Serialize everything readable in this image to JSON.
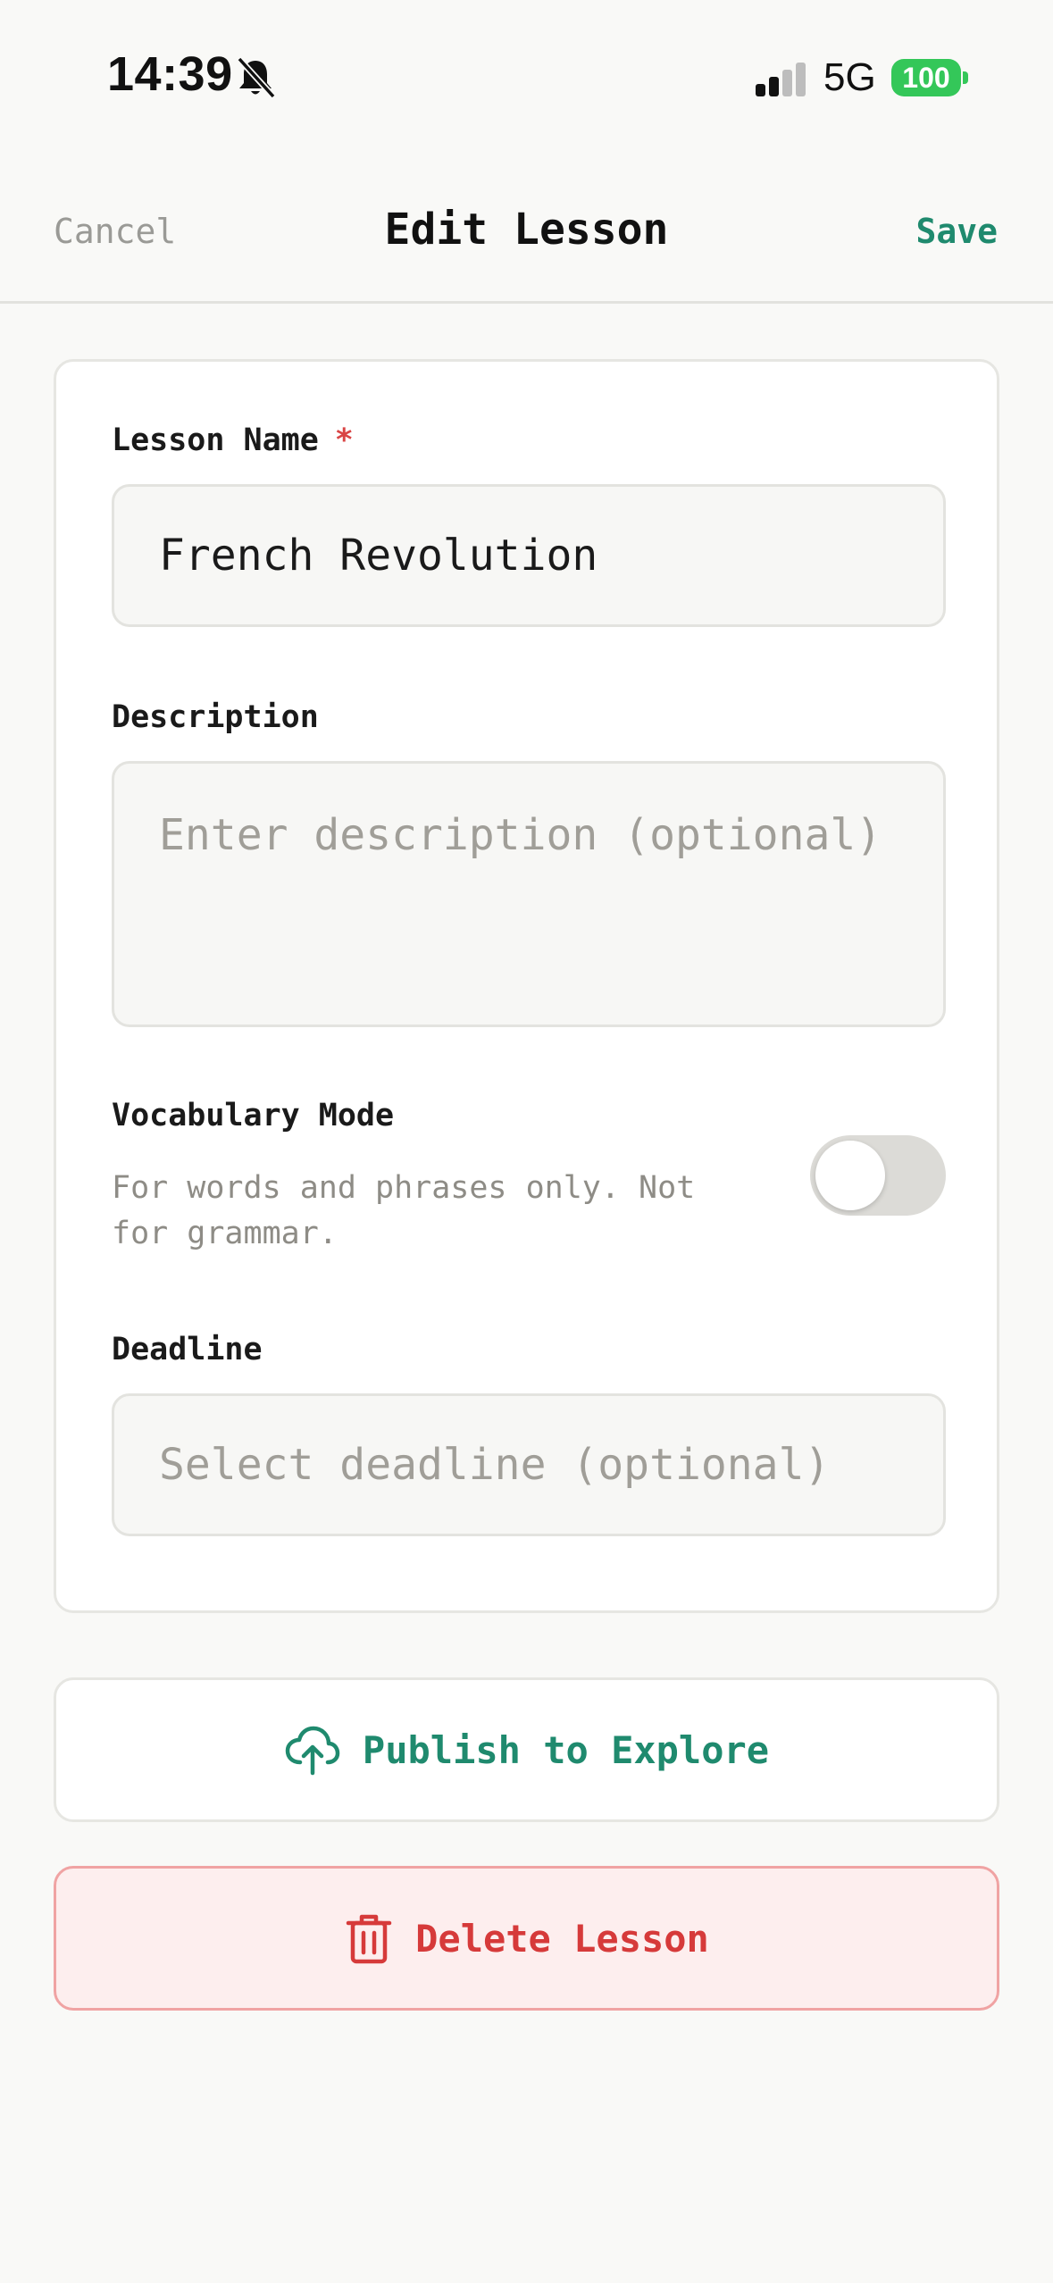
{
  "status_bar": {
    "time": "14:39",
    "network": "5G",
    "battery": "100",
    "icons": [
      "bell-slash-icon",
      "signal-icon"
    ]
  },
  "nav": {
    "cancel_label": "Cancel",
    "title": "Edit Lesson",
    "save_label": "Save"
  },
  "form": {
    "lesson_name": {
      "label": "Lesson Name",
      "required_mark": "*",
      "value": "French Revolution"
    },
    "description": {
      "label": "Description",
      "placeholder": "Enter description (optional)",
      "value": ""
    },
    "vocabulary_mode": {
      "label": "Vocabulary Mode",
      "helper": "For words and phrases only. Not for grammar.",
      "enabled": false
    },
    "deadline": {
      "label": "Deadline",
      "placeholder": "Select deadline (optional)"
    }
  },
  "actions": {
    "publish_label": "Publish to Explore",
    "publish_icon": "cloud-upload-icon",
    "delete_label": "Delete Lesson",
    "delete_icon": "trash-icon"
  },
  "colors": {
    "accent": "#1f8a6e",
    "danger": "#d63a3a",
    "battery": "#34c759"
  }
}
